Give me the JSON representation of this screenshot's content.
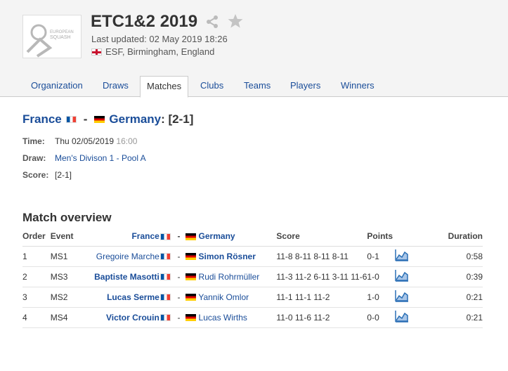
{
  "header": {
    "title": "ETC1&2 2019",
    "last_updated": "Last updated: 02 May 2019 18:26",
    "location": "ESF, Birmingham, England",
    "logo_text_1": "EUROPEAN",
    "logo_text_2": "SQUASH"
  },
  "tabs": [
    {
      "label": "Organization"
    },
    {
      "label": "Draws"
    },
    {
      "label": "Matches"
    },
    {
      "label": "Clubs"
    },
    {
      "label": "Teams"
    },
    {
      "label": "Players"
    },
    {
      "label": "Winners"
    }
  ],
  "match": {
    "team1": "France",
    "separator": "-",
    "team2": "Germany",
    "result": ": [2-1]",
    "time_label": "Time:",
    "time_date": "Thu 02/05/2019",
    "time_hour": "16:00",
    "draw_label": "Draw:",
    "draw_value": "Men's Divison 1 - Pool A",
    "score_label": "Score:",
    "score_value": "[2-1]"
  },
  "overview": {
    "title": "Match overview",
    "columns": {
      "order": "Order",
      "event": "Event",
      "team1": "France",
      "sep": "-",
      "team2": "Germany",
      "score": "Score",
      "points": "Points",
      "duration": "Duration"
    },
    "rows": [
      {
        "order": "1",
        "event": "MS1",
        "player1": "Gregoire Marche",
        "sep": "-",
        "player2": "Simon Rösner",
        "score": "11-8 8-11 8-11 8-11",
        "points": "0-1",
        "duration": "0:58"
      },
      {
        "order": "2",
        "event": "MS3",
        "player1": "Baptiste Masotti",
        "sep": "-",
        "player2": "Rudi Rohrmüller",
        "score": "11-3 11-2 6-11 3-11 11-6",
        "points": "1-0",
        "duration": "0:39"
      },
      {
        "order": "3",
        "event": "MS2",
        "player1": "Lucas Serme",
        "sep": "-",
        "player2": "Yannik Omlor",
        "score": "11-1 11-1 11-2",
        "points": "1-0",
        "duration": "0:21"
      },
      {
        "order": "4",
        "event": "MS4",
        "player1": "Victor Crouin",
        "sep": "-",
        "player2": "Lucas Wirths",
        "score": "11-0 11-6 11-2",
        "points": "0-0",
        "duration": "0:21"
      }
    ]
  },
  "colors": {
    "link": "#1a4d99",
    "header_bg": "#f4f4f4",
    "chart_icon": "#2a6fb5"
  }
}
